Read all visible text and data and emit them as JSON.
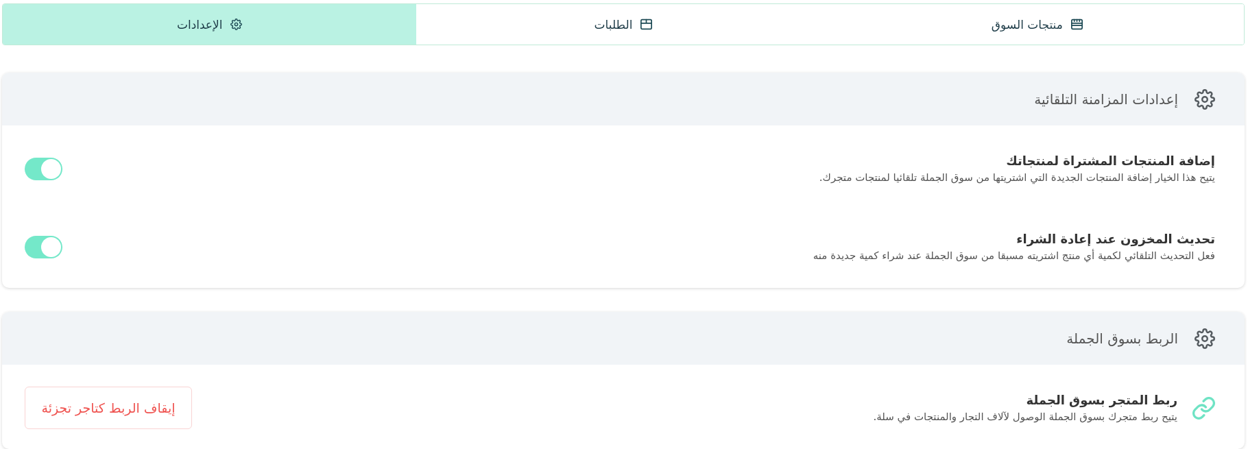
{
  "tabs": [
    {
      "label": "منتجات السوق",
      "selected": false
    },
    {
      "label": "الطلبات",
      "selected": false
    },
    {
      "label": "الإعدادات",
      "selected": true
    }
  ],
  "sections": [
    {
      "title": "إعدادات المزامنة التلقائية",
      "settings": [
        {
          "kind": "toggle",
          "title": "إضافة المنتجات المشتراة لمنتجاتك",
          "description": "يتيح هذا الخيار إضافة المنتجات الجديدة التي اشتريتها من سوق الجملة تلقائيا لمنتجات متجرك.",
          "on": true
        },
        {
          "kind": "toggle",
          "title": "تحديث المخزون عند إعادة الشراء",
          "description": "فعل التحديث التلقائي لكمية أي منتج اشتريته مسبقا من سوق الجملة عند شراء كمية جديدة منه",
          "on": true
        }
      ]
    },
    {
      "title": "الربط بسوق الجملة",
      "settings": [
        {
          "kind": "action",
          "title": "ربط المتجر بسوق الجملة",
          "description": "يتيح ربط متجرك بسوق الجملة الوصول لآلاف التجار والمنتجات في سلة.",
          "button": "إيقاف الربط كتاجر تجزئة"
        }
      ]
    }
  ]
}
